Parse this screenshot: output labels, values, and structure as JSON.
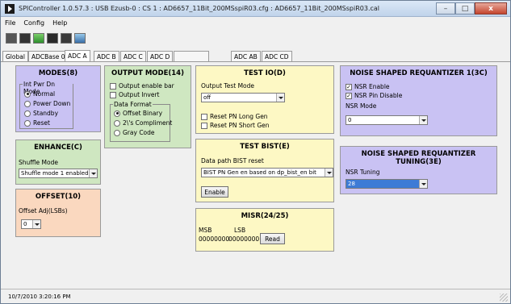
{
  "window": {
    "title": "SPIController 1.0.57.3 : USB Ezusb-0 : CS 1 : AD6657_11Bit_200MSspiR03.cfg : AD6657_11Bit_200MSspiR03.cal",
    "minimize": "–",
    "maximize": "□",
    "close": "x"
  },
  "menu": [
    "File",
    "Config",
    "Help"
  ],
  "toolbar": {
    "icons": [
      "save-icon",
      "chip-icon",
      "save-icon",
      "grid-icon",
      "monitor-icon",
      "image-icon"
    ]
  },
  "tabs": [
    "Global",
    "ADCBase 0",
    "ADC A",
    "ADC B",
    "ADC C",
    "ADC D",
    "",
    "ADC AB",
    "ADC CD"
  ],
  "active_tab": "ADC A",
  "modes": {
    "title": "MODES(8)",
    "group_label": "Int Pwr Dn Mode",
    "options": [
      "Normal",
      "Power Down",
      "Standby",
      "Reset"
    ],
    "selected": "Normal"
  },
  "output_mode": {
    "title": "OUTPUT MODE(14)",
    "checks": [
      "Output enable bar",
      "Output Invert"
    ],
    "group_label": "Data Format",
    "formats": [
      "Offset Binary",
      "2\\'s Compliment",
      "Gray Code"
    ],
    "selected": "Offset Binary"
  },
  "enhance": {
    "title": "ENHANCE(C)",
    "label": "Shuffle Mode",
    "value": "Shuffle mode 1 enabled"
  },
  "offset": {
    "title": "OFFSET(10)",
    "label": "Offset Adj(LSBs)",
    "value": "0"
  },
  "test_io": {
    "title": "TEST IO(D)",
    "label": "Output Test Mode",
    "value": "off",
    "checks": [
      "Reset PN Long Gen",
      "Reset PN Short Gen"
    ]
  },
  "test_bist": {
    "title": "TEST BIST(E)",
    "label": "Data path BIST reset",
    "value": "BIST PN Gen en based on dp_bist_en bit",
    "button": "Enable"
  },
  "misr": {
    "title": "MISR(24/25)",
    "msb_label": "MSB",
    "lsb_label": "LSB",
    "msb_value": "00000000",
    "lsb_value": "00000000",
    "button": "Read"
  },
  "nsr": {
    "title": "NOISE SHAPED REQUANTIZER 1(3C)",
    "checks": [
      "NSR Enable",
      "NSR Pin Disable"
    ],
    "mode_label": "NSR Mode",
    "mode_value": "0"
  },
  "nsr_tuning": {
    "title": "NOISE SHAPED REQUANTIZER TUNING(3E)",
    "label": "NSR Tuning",
    "value": "28"
  },
  "status": {
    "text": "10/7/2010 3:20:16 PM"
  },
  "colors": {
    "purple": "#c9c2f3",
    "green": "#cfe7c1",
    "yellow": "#fdf8c4",
    "peach": "#fad8bf",
    "selection": "#3d7bd6"
  }
}
